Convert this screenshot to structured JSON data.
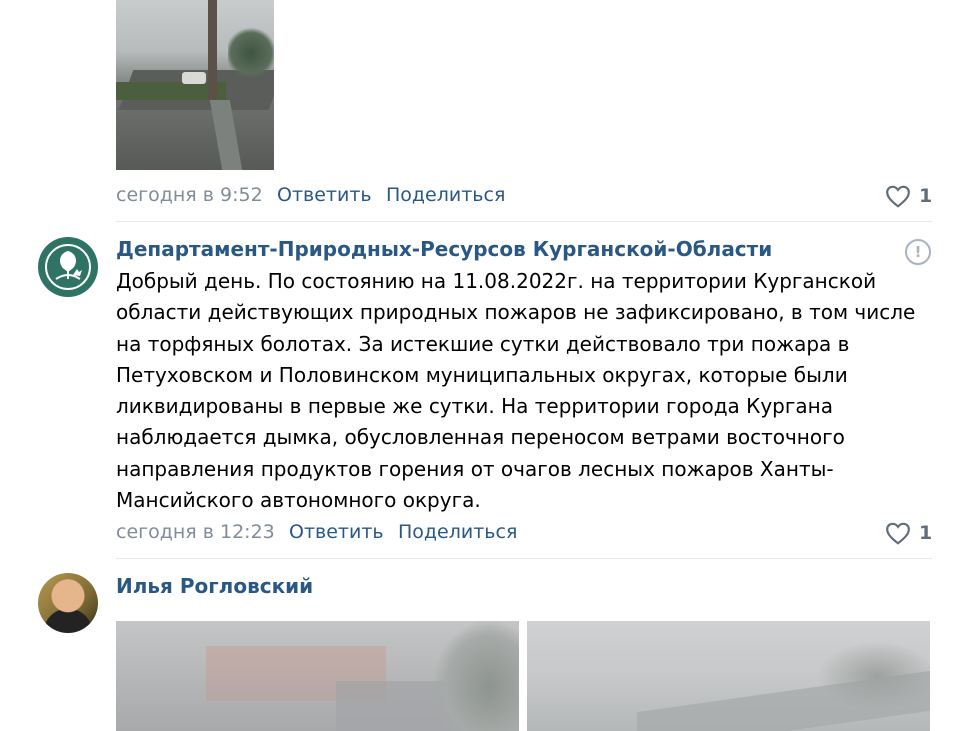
{
  "top_post": {
    "photo_icon": "street-photo",
    "timestamp": "сегодня в 9:52",
    "reply_label": "Ответить",
    "share_label": "Поделиться",
    "like_count": "1"
  },
  "comment1": {
    "author": "Департамент-Природных-Ресурсов Курганской-Области",
    "avatar_icon": "department-logo",
    "text": "Добрый день. По состоянию на 11.08.2022г. на территории Курганской области действующих природных пожаров не зафиксировано, в том числе на торфяных болотах. За истекшие сутки действовало три пожара в Петуховском и Половинском муниципальных округах, которые были ликвидированы в первые же сутки. На территории города Кургана наблюдается дымка, обусловленная переносом ветрами восточного направления продуктов горения от очагов лесных пожаров Ханты-Мансийского автономного округа.",
    "timestamp": "сегодня в 12:23",
    "reply_label": "Ответить",
    "share_label": "Поделиться",
    "like_count": "1",
    "report_icon": "!"
  },
  "comment2": {
    "author": "Илья Рогловский",
    "avatar_icon": "user-avatar",
    "photos": [
      "fog-photo-1",
      "fog-photo-2"
    ]
  },
  "colors": {
    "link": "#2a5885",
    "meta": "#818c99",
    "divider": "#e7e8ec",
    "department_logo_bg": "#2e7363"
  }
}
